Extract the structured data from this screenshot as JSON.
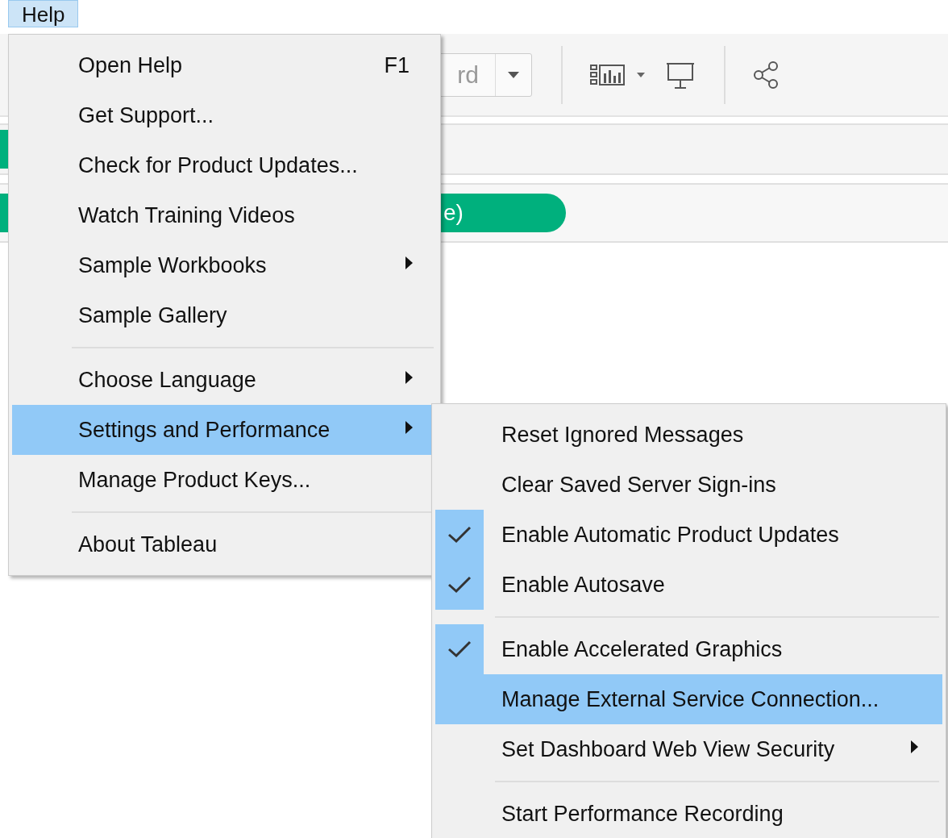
{
  "menu_bar": [
    {
      "label": "Help",
      "selected": true
    }
  ],
  "toolbar": {
    "dropdown_value": "rd"
  },
  "shelves": [
    {
      "kind": "plain"
    },
    {
      "kind": "pill",
      "pill": "e)"
    }
  ],
  "help_menu": [
    {
      "kind": "item",
      "label": "Open Help",
      "shortcut": "F1",
      "submenu": false,
      "selected": false
    },
    {
      "kind": "item",
      "label": "Get Support...",
      "submenu": false,
      "selected": false
    },
    {
      "kind": "item",
      "label": "Check for Product Updates...",
      "submenu": false,
      "selected": false
    },
    {
      "kind": "item",
      "label": "Watch Training Videos",
      "submenu": false,
      "selected": false
    },
    {
      "kind": "item",
      "label": "Sample Workbooks",
      "submenu": true,
      "selected": false
    },
    {
      "kind": "item",
      "label": "Sample Gallery",
      "submenu": false,
      "selected": false
    },
    {
      "kind": "separator"
    },
    {
      "kind": "item",
      "label": "Choose Language",
      "submenu": true,
      "selected": false
    },
    {
      "kind": "item",
      "label": "Settings and Performance",
      "submenu": true,
      "selected": true
    },
    {
      "kind": "item",
      "label": "Manage Product Keys...",
      "submenu": false,
      "selected": false
    },
    {
      "kind": "separator"
    },
    {
      "kind": "item",
      "label": "About Tableau",
      "submenu": false,
      "selected": false
    }
  ],
  "settings_submenu": [
    {
      "kind": "item",
      "label": "Reset Ignored Messages",
      "checked": false,
      "submenu": false,
      "selected": false
    },
    {
      "kind": "item",
      "label": "Clear Saved Server Sign-ins",
      "checked": false,
      "submenu": false,
      "selected": false
    },
    {
      "kind": "item",
      "label": "Enable Automatic Product Updates",
      "checked": true,
      "submenu": false,
      "selected": false
    },
    {
      "kind": "item",
      "label": "Enable Autosave",
      "checked": true,
      "submenu": false,
      "selected": false
    },
    {
      "kind": "separator"
    },
    {
      "kind": "item",
      "label": "Enable Accelerated Graphics",
      "checked": true,
      "submenu": false,
      "selected": false
    },
    {
      "kind": "item",
      "label": "Manage External Service Connection...",
      "checked": false,
      "submenu": false,
      "selected": true
    },
    {
      "kind": "item",
      "label": "Set Dashboard Web View Security",
      "checked": false,
      "submenu": true,
      "selected": false
    },
    {
      "kind": "separator"
    },
    {
      "kind": "item",
      "label": "Start Performance Recording",
      "checked": false,
      "submenu": false,
      "selected": false
    }
  ]
}
